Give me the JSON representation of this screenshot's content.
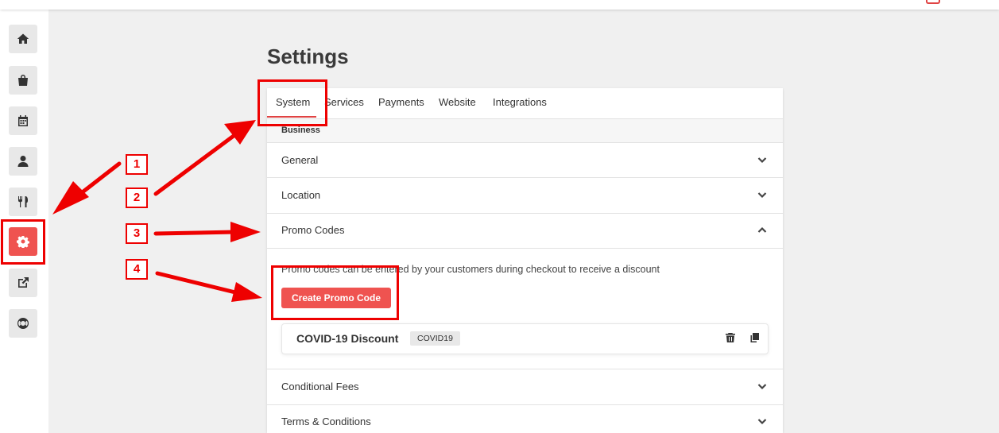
{
  "page_title": "Settings",
  "tabs": [
    {
      "label": "System",
      "active": true
    },
    {
      "label": "Services"
    },
    {
      "label": "Payments"
    },
    {
      "label": "Website"
    },
    {
      "label": "Integrations"
    }
  ],
  "section_header": "Business",
  "rows": {
    "general": "General",
    "location": "Location",
    "promo_codes": "Promo Codes",
    "conditional_fees": "Conditional Fees",
    "terms": "Terms & Conditions"
  },
  "promo": {
    "description": "Promo codes can be entered by your customers during checkout to receive a discount",
    "create_button": "Create Promo Code",
    "items": [
      {
        "name": "COVID-19 Discount",
        "code": "COVID19"
      }
    ]
  },
  "sidebar": {
    "items": [
      {
        "icon": "home-icon"
      },
      {
        "icon": "shopping-bag-icon"
      },
      {
        "icon": "calendar-icon"
      },
      {
        "icon": "user-icon"
      },
      {
        "icon": "utensils-icon"
      },
      {
        "icon": "gear-icon",
        "active": true
      },
      {
        "icon": "external-link-icon"
      },
      {
        "icon": "life-ring-icon"
      }
    ]
  },
  "annotations": {
    "markers": [
      "1",
      "2",
      "3",
      "4"
    ],
    "color": "#e00000"
  },
  "colors": {
    "accent": "#ef5350",
    "annotation": "#e00000"
  }
}
